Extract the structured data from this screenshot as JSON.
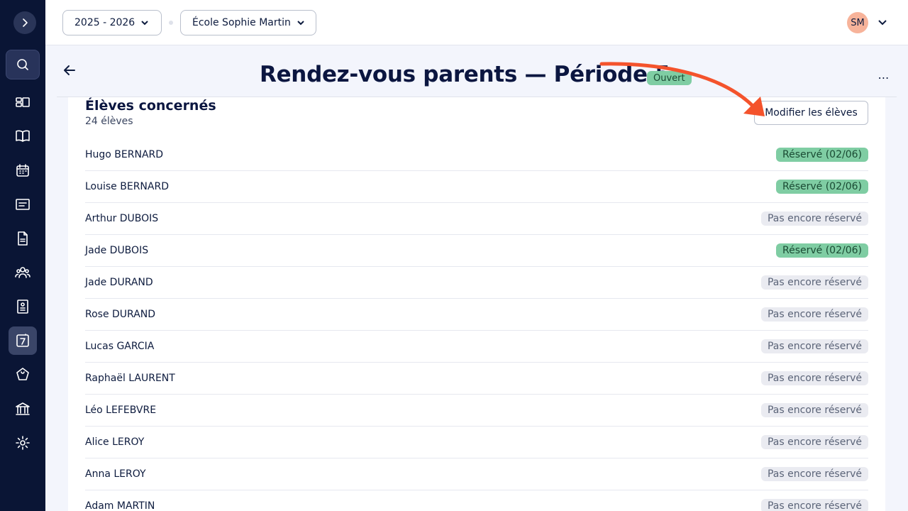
{
  "topbar": {
    "year_select": "2025 - 2026",
    "school_select": "École Sophie Martin",
    "user_initials": "SM"
  },
  "header": {
    "title": "Rendez-vous parents — Période 5",
    "status": "Ouvert"
  },
  "card": {
    "title": "Élèves concernés",
    "count": "24 élèves",
    "edit_button": "Modifier les élèves"
  },
  "students": [
    {
      "name": "Hugo BERNARD",
      "status": "Réservé (02/06)",
      "booked": true
    },
    {
      "name": "Louise BERNARD",
      "status": "Réservé (02/06)",
      "booked": true
    },
    {
      "name": "Arthur DUBOIS",
      "status": "Pas encore réservé",
      "booked": false
    },
    {
      "name": "Jade DUBOIS",
      "status": "Réservé (02/06)",
      "booked": true
    },
    {
      "name": "Jade DURAND",
      "status": "Pas encore réservé",
      "booked": false
    },
    {
      "name": "Rose DURAND",
      "status": "Pas encore réservé",
      "booked": false
    },
    {
      "name": "Lucas GARCIA",
      "status": "Pas encore réservé",
      "booked": false
    },
    {
      "name": "Raphaël LAURENT",
      "status": "Pas encore réservé",
      "booked": false
    },
    {
      "name": "Léo LEFEBVRE",
      "status": "Pas encore réservé",
      "booked": false
    },
    {
      "name": "Alice LEROY",
      "status": "Pas encore réservé",
      "booked": false
    },
    {
      "name": "Anna LEROY",
      "status": "Pas encore réservé",
      "booked": false
    },
    {
      "name": "Adam MARTIN",
      "status": "Pas encore réservé",
      "booked": false
    }
  ],
  "colors": {
    "sidebar": "#0a1535",
    "booked_badge": "#7fcda3",
    "pending_badge": "#eaebf1",
    "annotation_arrow": "#f4532c"
  },
  "icons": [
    "chevron-right-icon",
    "search-icon",
    "dashboard-icon",
    "book-icon",
    "calendar-icon",
    "message-board-icon",
    "document-icon",
    "group-icon",
    "notebook-icon",
    "meeting-icon",
    "puzzle-icon",
    "institution-icon",
    "gear-icon"
  ]
}
